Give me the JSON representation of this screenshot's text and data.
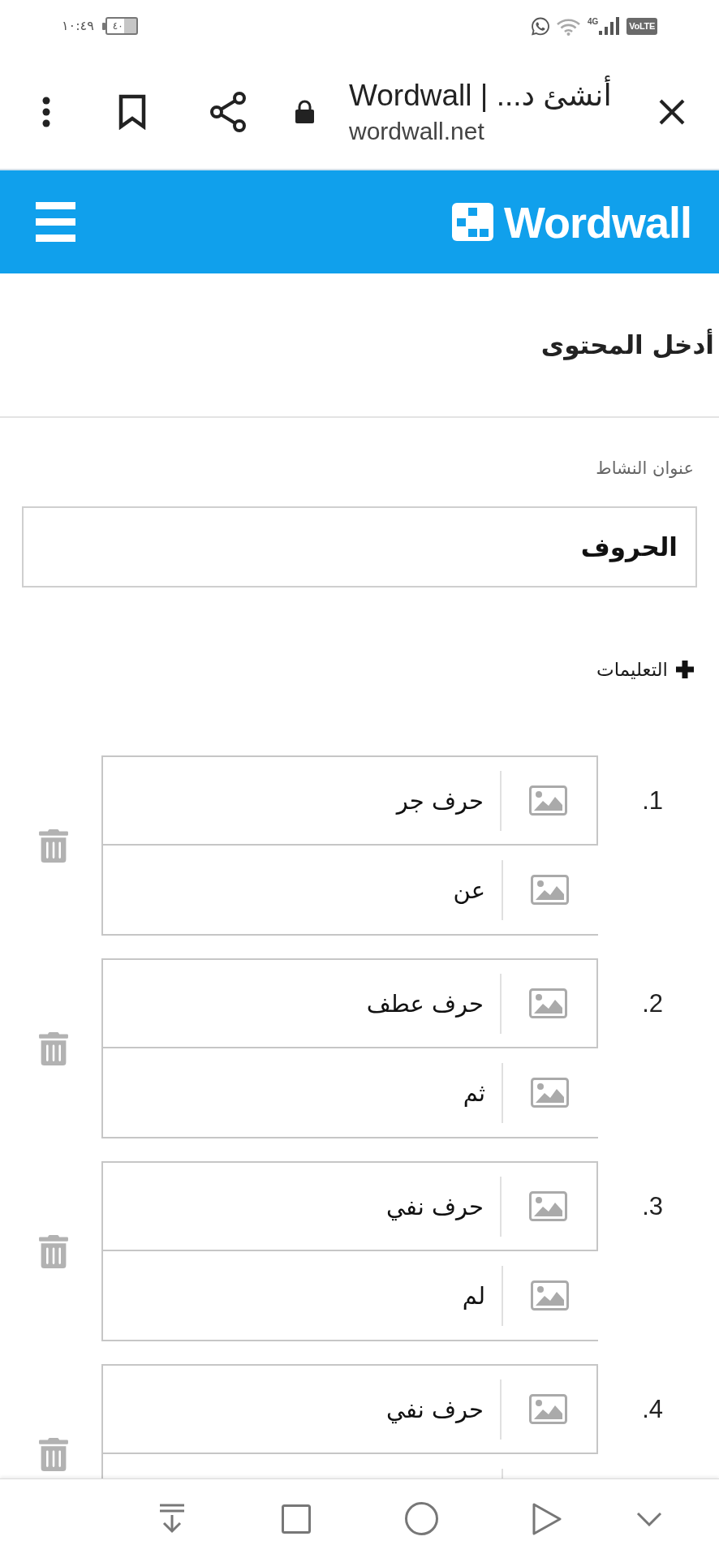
{
  "status_bar": {
    "time": "١٠:٤٩",
    "battery": "٤٠",
    "network": "4G",
    "volte": "VoLTE"
  },
  "browser_bar": {
    "title": "أنشئ د... | Wordwall",
    "url": "wordwall.net"
  },
  "site_header": {
    "logo_text": "Wordwall"
  },
  "heading": "أدخل المحتوى",
  "activity_title": {
    "label": "عنوان النشاط",
    "value": "الحروف"
  },
  "instructions": {
    "label": "التعليمات",
    "expanded": false
  },
  "items": [
    {
      "number": "1.",
      "term": "حرف جر",
      "definition": "عن"
    },
    {
      "number": "2.",
      "term": "حرف عطف",
      "definition": "ثم"
    },
    {
      "number": "3.",
      "term": "حرف نفي",
      "definition": "لم"
    },
    {
      "number": "4.",
      "term": "حرف نفي"
    }
  ]
}
